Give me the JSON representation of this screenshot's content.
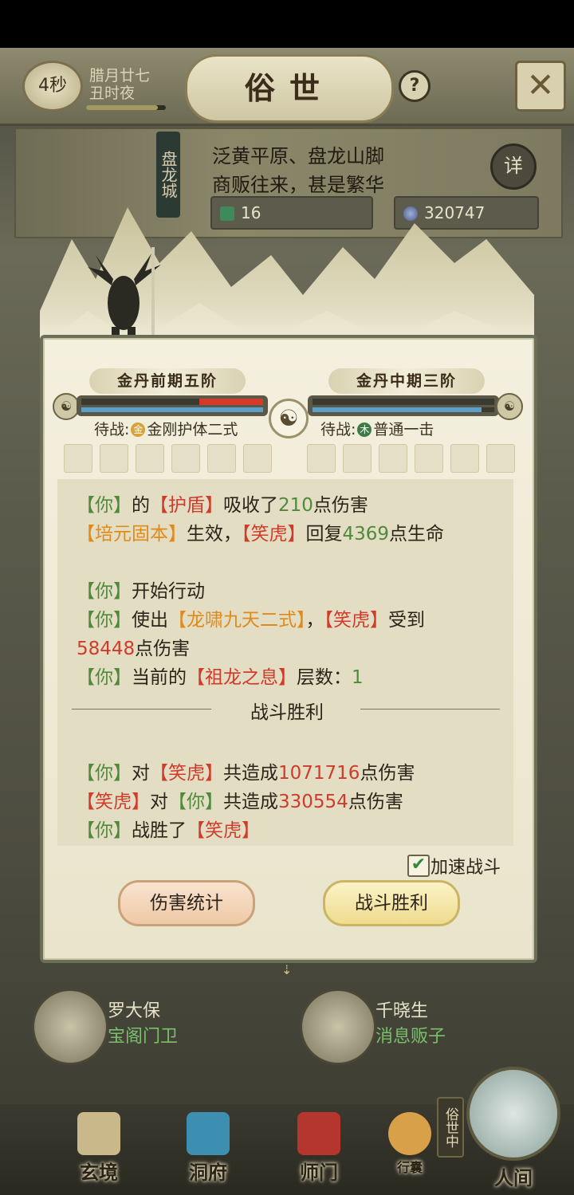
{
  "header": {
    "timer": "4秒",
    "date": "腊月廿七",
    "time_of_day": "丑时夜",
    "time_progress": 0.9,
    "title": "俗世",
    "help_icon": "question-icon",
    "close_icon": "close-icon"
  },
  "city": {
    "name": "盘龙城",
    "desc_line1": "泛黄平原、盘龙山脚",
    "desc_line2": "商贩往来，甚是繁华",
    "detail_button": "详",
    "resource1_value": "16",
    "resource2_value": "320747"
  },
  "battle": {
    "left_realm": "金丹前期五阶",
    "right_realm": "金丹中期三阶",
    "left_hp_fraction": 0.35,
    "left_mp_fraction": 1.0,
    "right_hp_fraction": 0.0,
    "right_mp_fraction": 0.93,
    "left_ready_prefix": "待战:",
    "left_ready_element": "金",
    "left_ready_skill": "金刚护体二式",
    "right_ready_prefix": "待战:",
    "right_ready_element": "木",
    "right_ready_skill": "普通一击",
    "log": [
      [
        {
          "t": "【你】",
          "c": "g"
        },
        {
          "t": "的"
        },
        {
          "t": "【护盾】",
          "c": "r"
        },
        {
          "t": "吸收了"
        },
        {
          "t": "210",
          "c": "g"
        },
        {
          "t": "点伤害"
        }
      ],
      [
        {
          "t": "【培元固本】",
          "c": "o"
        },
        {
          "t": "生效，"
        },
        {
          "t": "【笑虎】",
          "c": "r"
        },
        {
          "t": "回复"
        },
        {
          "t": "4369",
          "c": "g"
        },
        {
          "t": "点生命"
        }
      ],
      [
        {
          "t": "【你】",
          "c": "g"
        },
        {
          "t": "开始行动"
        }
      ],
      [
        {
          "t": "【你】",
          "c": "g"
        },
        {
          "t": "使出"
        },
        {
          "t": "【龙啸九天二式】",
          "c": "o"
        },
        {
          "t": "，"
        },
        {
          "t": "【笑虎】",
          "c": "r"
        },
        {
          "t": "受到"
        }
      ],
      [
        {
          "t": "58448",
          "c": "r"
        },
        {
          "t": "点伤害"
        }
      ],
      [
        {
          "t": "【你】",
          "c": "g"
        },
        {
          "t": "当前的"
        },
        {
          "t": "【祖龙之息】",
          "c": "r"
        },
        {
          "t": "层数："
        },
        {
          "t": "1",
          "c": "g"
        }
      ],
      [
        {
          "t": "【你】",
          "c": "g"
        },
        {
          "t": "对"
        },
        {
          "t": "【笑虎】",
          "c": "r"
        },
        {
          "t": "共造成"
        },
        {
          "t": "1071716",
          "c": "r"
        },
        {
          "t": "点伤害"
        }
      ],
      [
        {
          "t": "【笑虎】",
          "c": "r"
        },
        {
          "t": "对"
        },
        {
          "t": "【你】",
          "c": "g"
        },
        {
          "t": "共造成"
        },
        {
          "t": "330554",
          "c": "r"
        },
        {
          "t": "点伤害"
        }
      ],
      [
        {
          "t": "【你】",
          "c": "g"
        },
        {
          "t": "战胜了"
        },
        {
          "t": "【笑虎】",
          "c": "r"
        }
      ]
    ],
    "victory_heading": "战斗胜利",
    "speed_label": "加速战斗",
    "speed_checked": true,
    "damage_stats_button": "伤害统计",
    "victory_button": "战斗胜利"
  },
  "npcs": [
    {
      "name": "罗大保",
      "role": "宝阁门卫"
    },
    {
      "name": "千晓生",
      "role": "消息贩子"
    }
  ],
  "nav": {
    "items": [
      "玄境",
      "洞府",
      "师门",
      "行囊",
      "人间"
    ],
    "world_badge": "俗世中"
  },
  "colors": {
    "friendly": "#4f8a3a",
    "enemy": "#d03b2a",
    "skill": "#e08a1a",
    "hp_enemy_bar": "#d43a2a",
    "mp_bar": "#5aa0c8"
  }
}
